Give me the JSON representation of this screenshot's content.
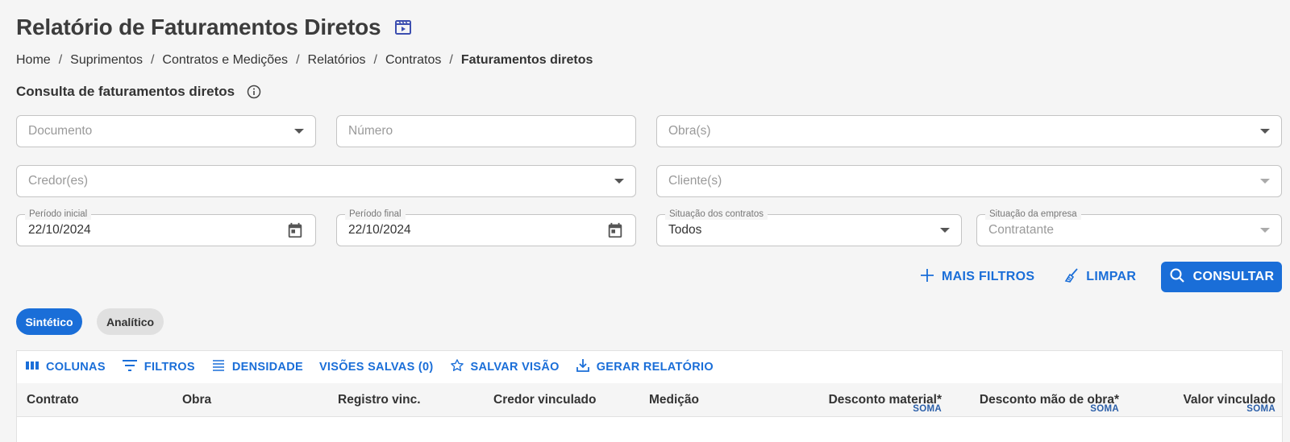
{
  "page": {
    "title": "Relatório de Faturamentos Diretos",
    "title_icon": "video-tutorial-icon"
  },
  "breadcrumb": [
    "Home",
    "Suprimentos",
    "Contratos e Medições",
    "Relatórios",
    "Contratos",
    "Faturamentos diretos"
  ],
  "section": {
    "title": "Consulta de faturamentos diretos",
    "info_icon": "info-icon"
  },
  "filters": {
    "documento": {
      "placeholder": "Documento"
    },
    "numero": {
      "placeholder": "Número"
    },
    "obras": {
      "placeholder": "Obra(s)"
    },
    "credores": {
      "placeholder": "Credor(es)"
    },
    "clientes": {
      "placeholder": "Cliente(s)"
    },
    "periodo_inicial": {
      "label": "Período inicial",
      "value": "22/10/2024"
    },
    "periodo_final": {
      "label": "Período final",
      "value": "22/10/2024"
    },
    "situacao_contratos": {
      "label": "Situação dos contratos",
      "value": "Todos"
    },
    "situacao_empresa": {
      "label": "Situação da empresa",
      "value": "Contratante"
    }
  },
  "actions": {
    "mais_filtros": "MAIS FILTROS",
    "limpar": "LIMPAR",
    "consultar": "CONSULTAR"
  },
  "view_tabs": {
    "sintetico": "Sintético",
    "analitico": "Analítico",
    "active": "Sintético"
  },
  "toolbar": {
    "colunas": "COLUNAS",
    "filtros": "FILTROS",
    "densidade": "DENSIDADE",
    "visoes_salvas": "VISÕES SALVAS (0)",
    "salvar_visao": "SALVAR VISÃO",
    "gerar_relatorio": "GERAR RELATÓRIO"
  },
  "table": {
    "columns": [
      "Contrato",
      "Obra",
      "Registro vinc.",
      "Credor vinculado",
      "Medição",
      "Desconto material*",
      "Desconto mão de obra*",
      "Valor vinculado"
    ],
    "aggregate_label": "SOMA",
    "rows": []
  },
  "colors": {
    "primary": "#1a6ed8",
    "background": "#f5f5f5",
    "chip_inactive": "#e0e0e0"
  }
}
